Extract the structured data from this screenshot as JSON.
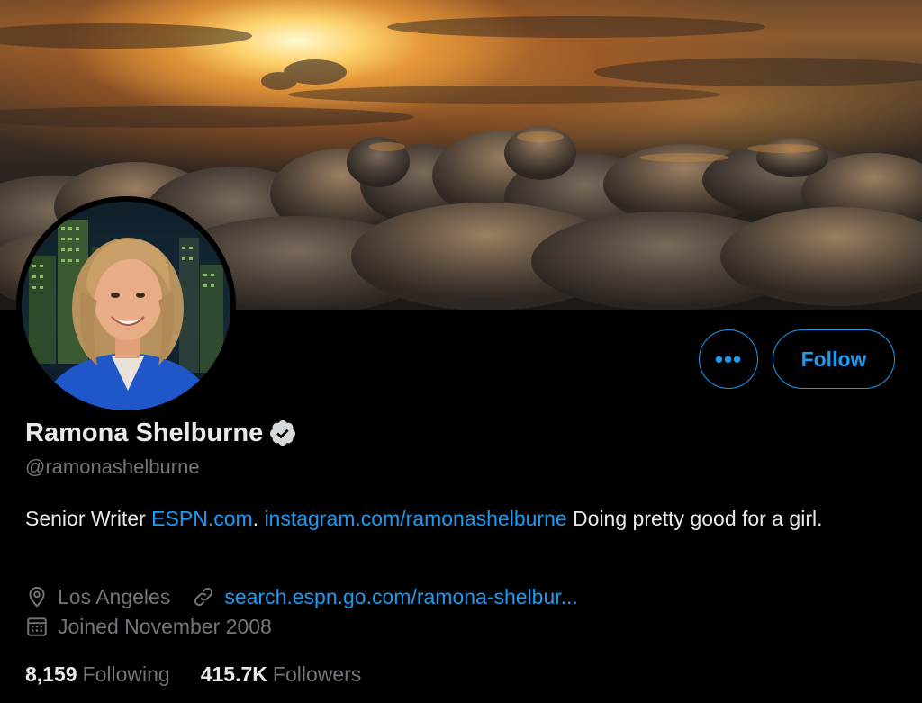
{
  "profile": {
    "display_name": "Ramona Shelburne",
    "handle": "@ramonashelburne",
    "verified": true,
    "bio": {
      "prefix": "Senior Writer ",
      "link1": "ESPN.com",
      "mid": ". ",
      "link2": "instagram.com/ramonashelburne",
      "suffix": " Doing pretty good for a girl."
    },
    "location": "Los Angeles",
    "website": "search.espn.go.com/ramona-shelbur...",
    "joined": "Joined November 2008",
    "following_count": "8,159",
    "following_label": "Following",
    "followers_count": "415.7K",
    "followers_label": "Followers"
  },
  "actions": {
    "more_label": "•••",
    "follow_label": "Follow"
  },
  "icons": {
    "verified": "verified-badge-icon",
    "location": "location-pin-icon",
    "website": "link-icon",
    "joined": "calendar-icon"
  },
  "colors": {
    "accent": "#1d9bf0",
    "background": "#000000",
    "primary_text": "#e7e9ea",
    "secondary_text": "#71767b"
  }
}
